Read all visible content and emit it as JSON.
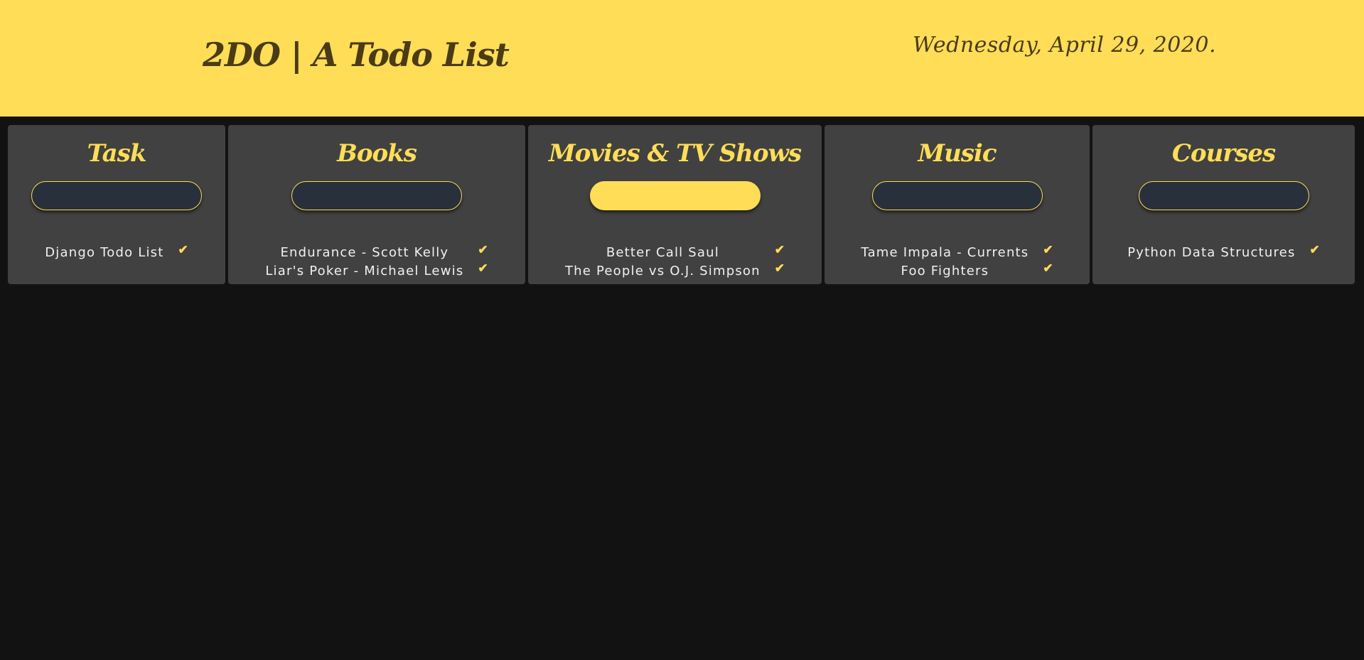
{
  "header": {
    "brand": "2DO | A Todo List",
    "date": "Wednesday, April 29, 2020."
  },
  "columns": [
    {
      "title": "Task",
      "items": [
        "Django Todo List"
      ]
    },
    {
      "title": "Books",
      "items": [
        "Endurance - Scott Kelly",
        "Liar's Poker - Michael Lewis"
      ]
    },
    {
      "title": "Movies & TV Shows",
      "items": [
        "Better Call Saul",
        "The People vs O.J. Simpson"
      ]
    },
    {
      "title": "Music",
      "items": [
        "Tame Impala - Currents",
        "Foo Fighters"
      ]
    },
    {
      "title": "Courses",
      "items": [
        "Python Data Structures"
      ]
    }
  ],
  "icons": {
    "done": "check-icon"
  },
  "colors": {
    "accent": "#ffdd57",
    "background": "#121212",
    "card": "#414141",
    "input": "#28313b",
    "heading_dark": "#4a3b14"
  }
}
